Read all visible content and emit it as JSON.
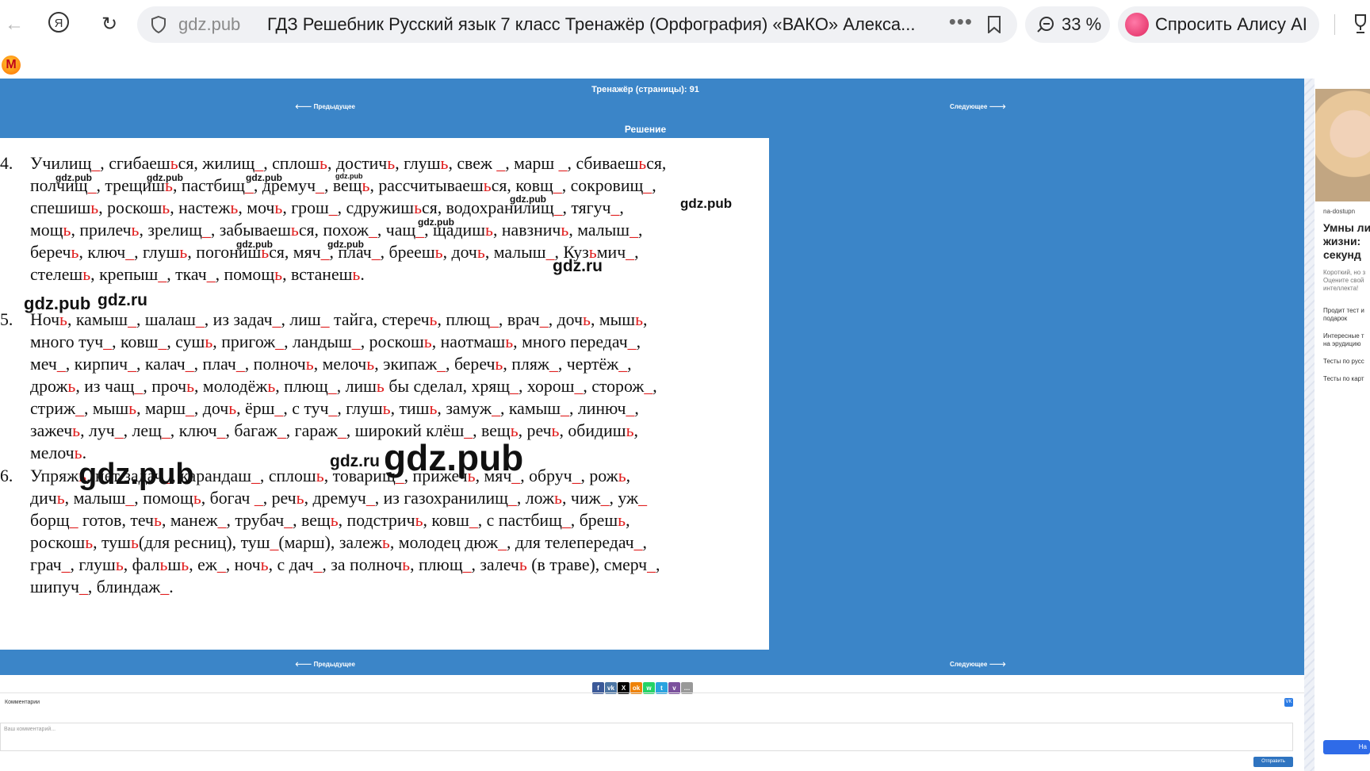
{
  "browser": {
    "domain": "gdz.pub",
    "page_title": "ГДЗ Решебник Русский язык 7 класс Тренажёр (Орфография) «ВАКО» Алекса...",
    "more_dots": "•••",
    "zoom": "33 %",
    "alice_label": "Спросить Алису AI"
  },
  "page": {
    "header": "Тренажёр (страницы): 91",
    "prev_label": "🡐 Предыдущее",
    "next_label": "Следующее 🡒",
    "solution_label": "Решение",
    "exercises": [
      {
        "num": "4.",
        "lines": [
          [
            [
              "Училищ",
              ""
            ],
            [
              "_",
              ""
            ],
            [
              ", сгибаешь",
              ""
            ],
            [
              "ся, жилищ",
              ""
            ],
            [
              "_, сплошь, достичь, глушь, свеж _, марш _, сбиваешься,",
              ""
            ]
          ],
          [
            [
              "полчищ_, трещишь, пастбищ_, дремуч_, вещь, рассчитываешься, ковщ_, сокровищ_,",
              ""
            ]
          ],
          [
            [
              "спешишь, роскошь, настежь, мочь, грош_, сдружишься, водохранилищ_, тягуч_,",
              ""
            ]
          ],
          [
            [
              "мощь, прилечь, зрелищ_, забываешься, похож_, чащ_, щадишь, навзничь, малыш_,",
              ""
            ]
          ],
          [
            [
              "беречь, ключ_, глушь, погонишься, мяч_, плач_, бреешь, дочь, малыш_, Кузьмич_,",
              ""
            ]
          ],
          [
            [
              "стелешь, крепыш_, ткач_, помощь, встанешь.",
              ""
            ]
          ]
        ]
      },
      {
        "num": "5.",
        "lines": [
          [
            [
              "Ночь, камыш_, шалаш_, из задач_, лиш_ тайга, стеречь, плющ_, врач_, дочь, мышь,",
              ""
            ]
          ],
          [
            [
              "много туч_, ковш_, сушь, пригож_, ландыш_, роскошь, наотмашь, много передач_,",
              ""
            ]
          ],
          [
            [
              "меч_, кирпич_, калач_, плач_, полночь, мелочь, экипаж_, беречь, пляж_, чертёж_,",
              ""
            ]
          ],
          [
            [
              "дрожь, из чащ_, прочь, молодёжь, плющ_, лишь бы сделал, хрящ_, хорош_, сторож_,",
              ""
            ]
          ],
          [
            [
              "стриж_, мышь, марш_, дочь, ёрш_, с туч_, глушь, тишь, замуж_, камыш_, линюч_,",
              ""
            ]
          ],
          [
            [
              "зажечь, луч_, лещ_, ключ_, багаж_, гараж_, широкий клёш_, вещь, речь, обидишь,",
              ""
            ]
          ],
          [
            [
              "мелочь.",
              ""
            ]
          ]
        ]
      },
      {
        "num": "6.",
        "lines": [
          [
            [
              "Упряжь, нет задач_, карандаш_, сплошь, товарищ_, прижечь, мяч_, обруч_, рожь,",
              ""
            ]
          ],
          [
            [
              "дичь, малыш_, помощь, богач _, речь, дремуч_, из газохранилищ_, ложь, чиж_, уж_",
              ""
            ]
          ],
          [
            [
              "борщ_ готов, течь, манеж_, трубач_, вещь, подстричь, ковш_, с пастбищ_, брешь,",
              ""
            ]
          ],
          [
            [
              "роскошь, тушь(для ресниц), туш_(марш), залежь, молодец дюж_, для телепередач_,",
              ""
            ]
          ],
          [
            [
              "грач_, глушь, фальшь, еж_, ночь, с дач_, за полночь, плющ_, залечь (в траве), смерч_,",
              ""
            ]
          ],
          [
            [
              "шипуч_, блиндаж_.",
              ""
            ]
          ]
        ]
      }
    ],
    "watermarks": {
      "small": "gdz.pub",
      "ru": "gdz.ru",
      "big": "gdz.pub"
    },
    "comments_label": "Комментарии",
    "comment_placeholder": "Ваш комментарий...",
    "send_label": "Отправить",
    "vk_badge": "VK",
    "share_icons": [
      "f",
      "vk",
      "X",
      "ok",
      "wa",
      "tg",
      "vb",
      "•••"
    ]
  },
  "ad": {
    "source": "na-dostupn",
    "headline_1": "Умны ли",
    "headline_2": "жизни:",
    "headline_3": "секунд",
    "desc_1": "Короткий, но з",
    "desc_2": "Оцените свой",
    "desc_3": "интеллекта!",
    "link_1a": "Продит тест и",
    "link_1b": "подарок",
    "link_2a": "Интересные т",
    "link_2b": "на эрудицию",
    "link_3": "Тесты по русс",
    "link_4": "Тесты по карт",
    "button": "На"
  },
  "colors": {
    "page_blue": "#3b85c8",
    "marked_red": "#e02020"
  }
}
